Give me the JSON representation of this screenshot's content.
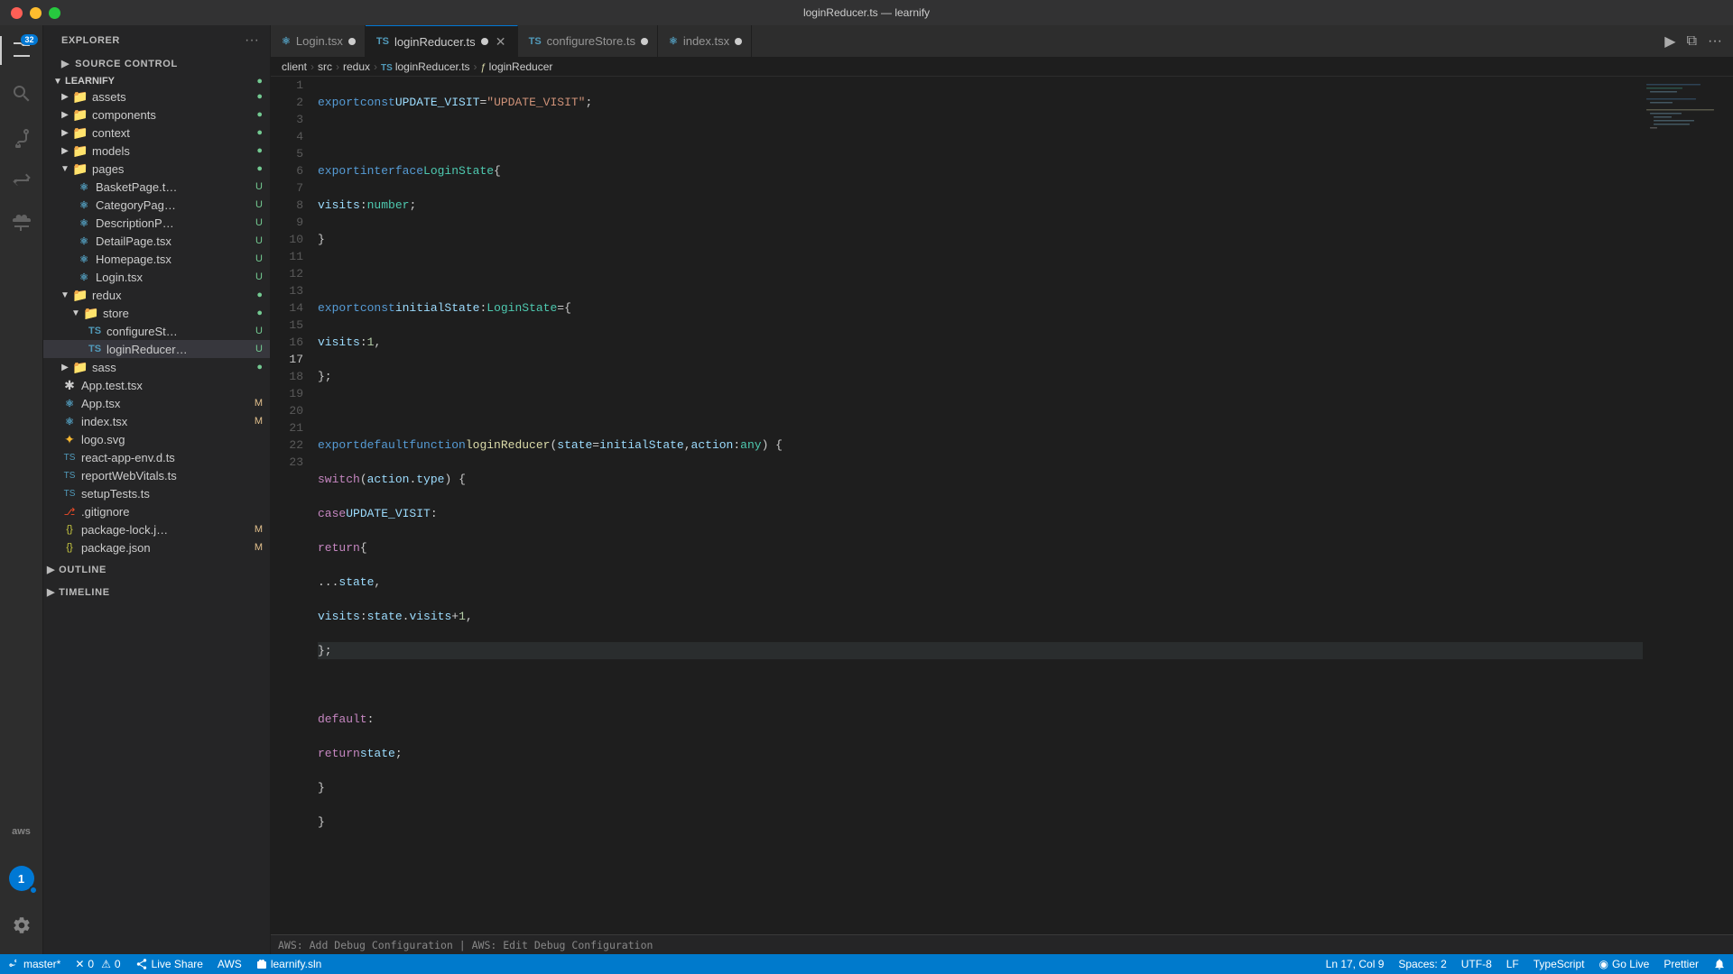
{
  "titlebar": {
    "title": "loginReducer.ts — learnify"
  },
  "activity": {
    "icons": [
      {
        "name": "files-icon",
        "symbol": "⧉",
        "active": true,
        "badge": "32"
      },
      {
        "name": "search-icon",
        "symbol": "🔍",
        "active": false
      },
      {
        "name": "source-control-icon",
        "symbol": "⎇",
        "active": false
      },
      {
        "name": "debug-icon",
        "symbol": "▶",
        "active": false
      },
      {
        "name": "extensions-icon",
        "symbol": "⊞",
        "active": false
      }
    ],
    "bottom": [
      {
        "name": "remote-icon",
        "symbol": "aws"
      },
      {
        "name": "account-icon",
        "symbol": "👤"
      },
      {
        "name": "settings-icon",
        "symbol": "⚙"
      }
    ]
  },
  "sidebar": {
    "title": "EXPLORER",
    "source_control_label": "SOURCE CONTROL",
    "project_name": "LEARNIFY",
    "tree": [
      {
        "id": "assets",
        "label": "assets",
        "type": "folder",
        "indent": 1,
        "expanded": false,
        "badge": "●",
        "badge_type": "u"
      },
      {
        "id": "components",
        "label": "components",
        "type": "folder",
        "indent": 1,
        "expanded": false,
        "badge": "●",
        "badge_type": "u"
      },
      {
        "id": "context",
        "label": "context",
        "type": "folder",
        "indent": 1,
        "expanded": false,
        "badge": "●",
        "badge_type": "u"
      },
      {
        "id": "models",
        "label": "models",
        "type": "folder",
        "indent": 1,
        "expanded": false,
        "badge": "●",
        "badge_type": "u"
      },
      {
        "id": "pages",
        "label": "pages",
        "type": "folder",
        "indent": 1,
        "expanded": true,
        "badge": "●",
        "badge_type": "u"
      },
      {
        "id": "BasketPage",
        "label": "BasketPage.t…",
        "type": "tsx",
        "indent": 2,
        "badge": "U"
      },
      {
        "id": "CategoryPage",
        "label": "CategoryPag…",
        "type": "tsx",
        "indent": 2,
        "badge": "U"
      },
      {
        "id": "DescriptionP",
        "label": "DescriptionP…",
        "type": "tsx",
        "indent": 2,
        "badge": "U"
      },
      {
        "id": "DetailPage",
        "label": "DetailPage.tsx",
        "type": "tsx",
        "indent": 2,
        "badge": "U"
      },
      {
        "id": "Homepage",
        "label": "Homepage.tsx",
        "type": "tsx",
        "indent": 2,
        "badge": "U"
      },
      {
        "id": "Login",
        "label": "Login.tsx",
        "type": "tsx",
        "indent": 2,
        "badge": "U"
      },
      {
        "id": "redux",
        "label": "redux",
        "type": "folder",
        "indent": 1,
        "expanded": true,
        "badge": "●",
        "badge_type": "u"
      },
      {
        "id": "store",
        "label": "store",
        "type": "folder",
        "indent": 2,
        "expanded": true,
        "badge": "●",
        "badge_type": "u"
      },
      {
        "id": "configureSt",
        "label": "configureSt…",
        "type": "ts",
        "indent": 3,
        "badge": "U"
      },
      {
        "id": "loginReducer",
        "label": "loginReducer…",
        "type": "ts",
        "indent": 3,
        "badge": "U",
        "active": true
      },
      {
        "id": "sass",
        "label": "sass",
        "type": "folder",
        "indent": 1,
        "expanded": false,
        "badge": "●",
        "badge_type": "u"
      },
      {
        "id": "App.test",
        "label": "App.test.tsx",
        "type": "test",
        "indent": 1
      },
      {
        "id": "App",
        "label": "App.tsx",
        "type": "tsx",
        "indent": 1,
        "badge": "M"
      },
      {
        "id": "index.tsx",
        "label": "index.tsx",
        "type": "tsx",
        "indent": 1,
        "badge": "M"
      },
      {
        "id": "logo.svg",
        "label": "logo.svg",
        "type": "svg",
        "indent": 1
      },
      {
        "id": "react-app-env",
        "label": "react-app-env.d.ts",
        "type": "ts",
        "indent": 1
      },
      {
        "id": "reportWebVitals",
        "label": "reportWebVitals.ts",
        "type": "ts",
        "indent": 1
      },
      {
        "id": "setupTests",
        "label": "setupTests.ts",
        "type": "ts",
        "indent": 1
      },
      {
        "id": "gitignore",
        "label": ".gitignore",
        "type": "git",
        "indent": 1
      },
      {
        "id": "package-lock",
        "label": "package-lock.j…",
        "type": "json",
        "indent": 1,
        "badge": "M"
      },
      {
        "id": "package.json",
        "label": "package.json",
        "type": "json",
        "indent": 1,
        "badge": "M"
      }
    ],
    "outline_label": "OUTLINE",
    "timeline_label": "TIMELINE"
  },
  "tabs": [
    {
      "id": "login-tab",
      "label": "Login.tsx",
      "type": "tsx",
      "modified": true,
      "active": false
    },
    {
      "id": "loginreducer-tab",
      "label": "loginReducer.ts",
      "type": "ts",
      "modified": true,
      "active": true
    },
    {
      "id": "configurestore-tab",
      "label": "configureStore.ts",
      "type": "ts",
      "modified": true,
      "active": false
    },
    {
      "id": "index-tab",
      "label": "index.tsx",
      "type": "tsx",
      "modified": true,
      "active": false
    }
  ],
  "breadcrumb": {
    "parts": [
      "client",
      "src",
      "redux",
      "loginReducer.ts",
      "loginReducer"
    ]
  },
  "editor": {
    "filename": "loginReducer.ts",
    "lines": [
      {
        "num": 1,
        "content": "export const UPDATE_VISIT = \"UPDATE_VISIT\";"
      },
      {
        "num": 2,
        "content": ""
      },
      {
        "num": 3,
        "content": "export interface LoginState {"
      },
      {
        "num": 4,
        "content": "    visits: number;"
      },
      {
        "num": 5,
        "content": "}"
      },
      {
        "num": 6,
        "content": ""
      },
      {
        "num": 7,
        "content": "export const initialState: LoginState = {"
      },
      {
        "num": 8,
        "content": "    visits: 1,"
      },
      {
        "num": 9,
        "content": "};"
      },
      {
        "num": 10,
        "content": ""
      },
      {
        "num": 11,
        "content": "export default function loginReducer(state = initialState, action: any) {"
      },
      {
        "num": 12,
        "content": "    switch (action.type) {"
      },
      {
        "num": 13,
        "content": "        case UPDATE_VISIT:"
      },
      {
        "num": 14,
        "content": "            return {"
      },
      {
        "num": 15,
        "content": "                ...state,"
      },
      {
        "num": 16,
        "content": "                visits: state.visits + 1,"
      },
      {
        "num": 17,
        "content": "            };"
      },
      {
        "num": 18,
        "content": ""
      },
      {
        "num": 19,
        "content": "        default:"
      },
      {
        "num": 20,
        "content": "            return state;"
      },
      {
        "num": 21,
        "content": "    }"
      },
      {
        "num": 22,
        "content": "}"
      },
      {
        "num": 23,
        "content": ""
      }
    ],
    "hint_line": "AWS: Add Debug Configuration | AWS: Edit Debug Configuration",
    "active_line": 17
  },
  "statusbar": {
    "branch": "master*",
    "errors": "0",
    "warnings": "0",
    "live_share": "Live Share",
    "aws": "AWS",
    "solution": "learnify.sln",
    "encoding": "UTF-8",
    "line_ending": "LF",
    "language": "TypeScript",
    "go_live": "Go Live",
    "prettier": "Prettier",
    "line_col": "Ln 17, Col 9",
    "spaces": "Spaces: 2"
  }
}
